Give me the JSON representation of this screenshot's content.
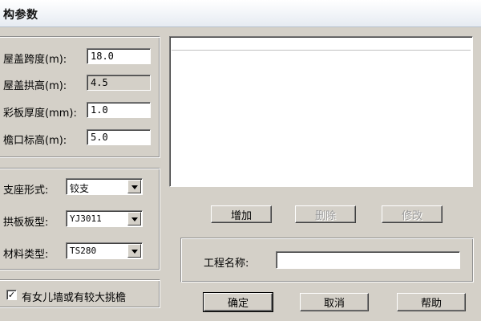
{
  "window": {
    "title": "构参数"
  },
  "params": [
    {
      "label": "屋盖跨度(m):",
      "value": "18.0"
    },
    {
      "label": "屋盖拱高(m):",
      "value": "4.5"
    },
    {
      "label": "彩板厚度(mm):",
      "value": "1.0"
    },
    {
      "label": "檐口标高(m):",
      "value": "5.0"
    }
  ],
  "selects": [
    {
      "label": "支座形式:",
      "value": "铰支"
    },
    {
      "label": "拱板板型:",
      "value": "YJ3011"
    },
    {
      "label": "材料类型:",
      "value": "TS280"
    }
  ],
  "checkbox": {
    "label": "有女儿墙或有较大挑檐",
    "checked": true,
    "mark": "✓"
  },
  "list_buttons": {
    "add": "增加",
    "delete": "删除",
    "modify": "修改"
  },
  "project": {
    "label": "工程名称:",
    "value": ""
  },
  "dialog_buttons": {
    "ok": "确定",
    "cancel": "取消",
    "help": "帮助"
  }
}
